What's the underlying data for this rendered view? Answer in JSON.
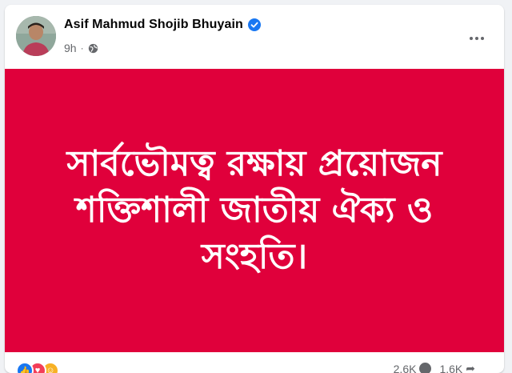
{
  "post": {
    "author": "Asif Mahmud Shojib Bhuyain",
    "time": "9h",
    "separator": "·",
    "image_text_lines": [
      "সার্বভৌমত্ব রক্ষায় প্রয়োজন",
      "শক্তিশালী জাতীয় ঐক্য ও",
      "সংহতি।"
    ],
    "comment_count": "2.6K",
    "share_count": "1.6K"
  },
  "icons": {
    "verified": "verified-badge-icon",
    "privacy": "globe-icon",
    "more": "more-options-icon",
    "reactions": [
      "like-icon",
      "love-icon",
      "haha-icon"
    ]
  },
  "colors": {
    "image_background": "#e0003b",
    "verified": "#1877f2",
    "text_secondary": "#65676b"
  }
}
